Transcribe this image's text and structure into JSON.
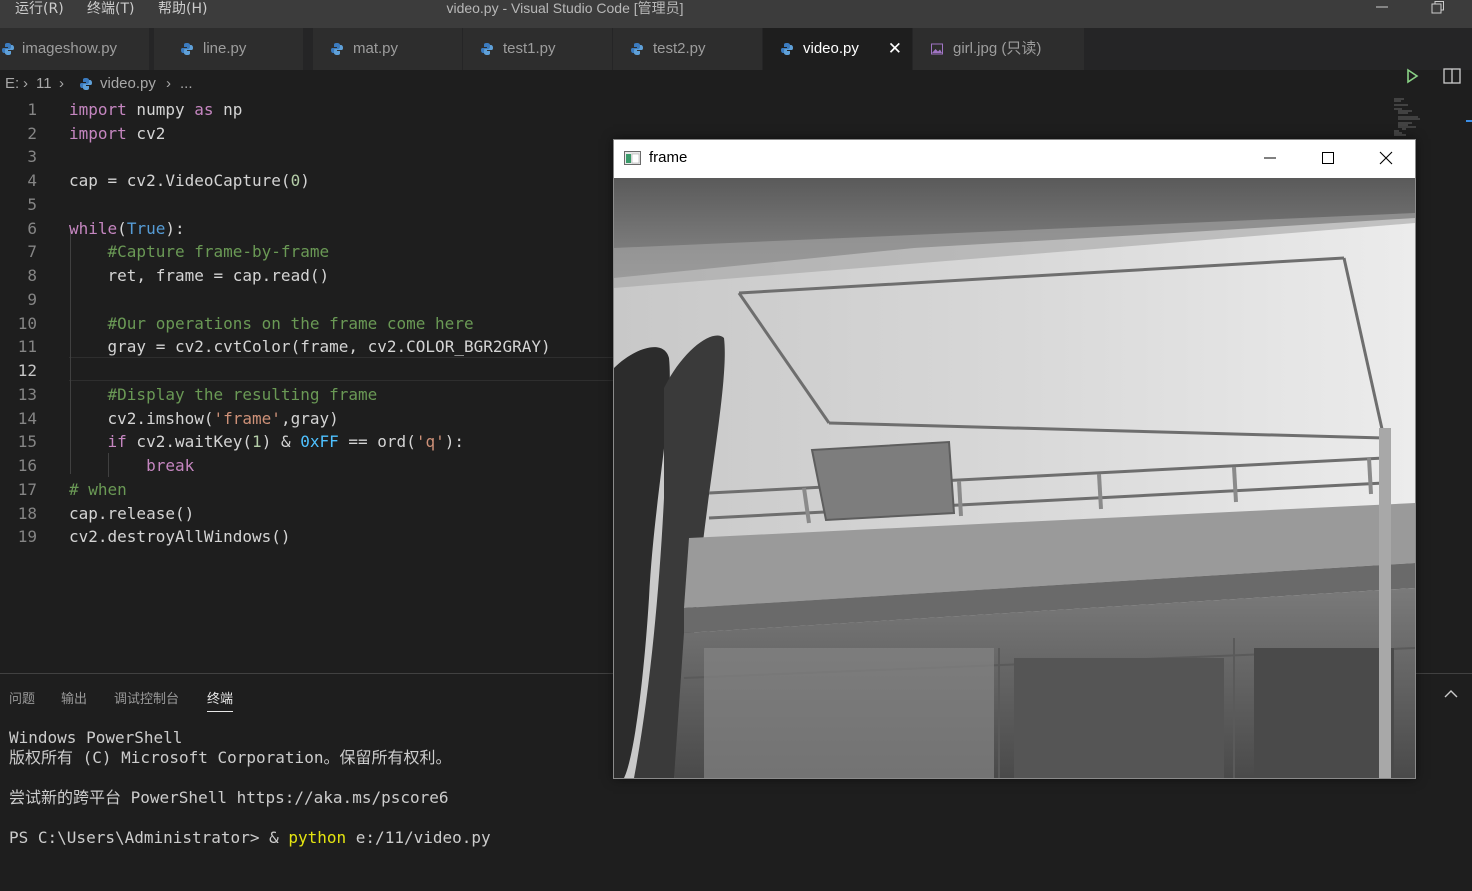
{
  "titlebar": {
    "menus": [
      "运行(R)",
      "终端(T)",
      "帮助(H)"
    ],
    "title": "video.py - Visual Studio Code [管理员]",
    "icon_names": [
      "minimize-icon",
      "restore-icon"
    ]
  },
  "tabs": [
    {
      "label": "imageshow.py",
      "active": false
    },
    {
      "label": "line.py",
      "active": false
    },
    {
      "label": "mat.py",
      "active": false
    },
    {
      "label": "test1.py",
      "active": false
    },
    {
      "label": "test2.py",
      "active": false
    },
    {
      "label": "video.py",
      "active": true
    },
    {
      "label": "girl.jpg (只读)",
      "active": false
    }
  ],
  "breadcrumb": {
    "drive": "E:",
    "folder": "11",
    "file": "video.py",
    "more": "..."
  },
  "editor": {
    "current_line": "12",
    "line_numbers": [
      "1",
      "2",
      "3",
      "4",
      "5",
      "6",
      "7",
      "8",
      "9",
      "10",
      "11",
      "12",
      "13",
      "14",
      "15",
      "16",
      "17",
      "18",
      "19"
    ],
    "code": {
      "l1a": "import",
      "l1b": " numpy ",
      "l1c": "as",
      "l1d": " np",
      "l2a": "import",
      "l2b": " cv2",
      "l4a": "cap = cv2.",
      "l4b": "VideoCapture",
      "l4c": "(",
      "l4d": "0",
      "l4e": ")",
      "l6a": "while",
      "l6b": "(",
      "l6c": "True",
      "l6d": "):",
      "l7": "    #Capture frame-by-frame",
      "l8a": "    ret, frame = cap.",
      "l8b": "read",
      "l8c": "()",
      "l10": "    #Our operations on the frame come here",
      "l11a": "    gray = cv2.",
      "l11b": "cvtColor",
      "l11c": "(frame, cv2.COLOR_BGR2GRAY)",
      "l13": "    #Display the resulting frame",
      "l14a": "    cv2.",
      "l14b": "imshow",
      "l14c": "(",
      "l14d": "'frame'",
      "l14e": ",gray)",
      "l15a": "    ",
      "l15b": "if",
      "l15c": " cv2.",
      "l15d": "waitKey",
      "l15e": "(",
      "l15f": "1",
      "l15g": ") & ",
      "l15h": "0xFF",
      "l15i": " == ",
      "l15j": "ord",
      "l15k": "(",
      "l15l": "'q'",
      "l15m": "):",
      "l16a": "        ",
      "l16b": "break",
      "l17": "# when",
      "l18a": "cap.",
      "l18b": "release",
      "l18c": "()",
      "l19a": "cv2.",
      "l19b": "destroyAllWindows",
      "l19c": "()"
    }
  },
  "panel": {
    "tabs": [
      "问题",
      "输出",
      "调试控制台",
      "终端"
    ],
    "active_tab": "终端",
    "terminal": {
      "line1": "Windows PowerShell",
      "line2": "版权所有 (C) Microsoft Corporation。保留所有权利。",
      "line3": "尝试新的跨平台 PowerShell https://aka.ms/pscore6",
      "line4a": "PS C:\\Users\\Administrator> & ",
      "line4b": "python",
      "line4c": " e:/11/video.py"
    }
  },
  "frame_window": {
    "title": "frame",
    "content": "grayscale webcam frame"
  },
  "colors": {
    "keyword": "#c586c0",
    "builtin": "#569cd6",
    "function": "#dcdcaa",
    "comment": "#6a9955",
    "string": "#ce9178",
    "number": "#b5cea8",
    "constant": "#4fc1ff",
    "terminal_command": "#e5e510",
    "run_green": "#89d185"
  }
}
